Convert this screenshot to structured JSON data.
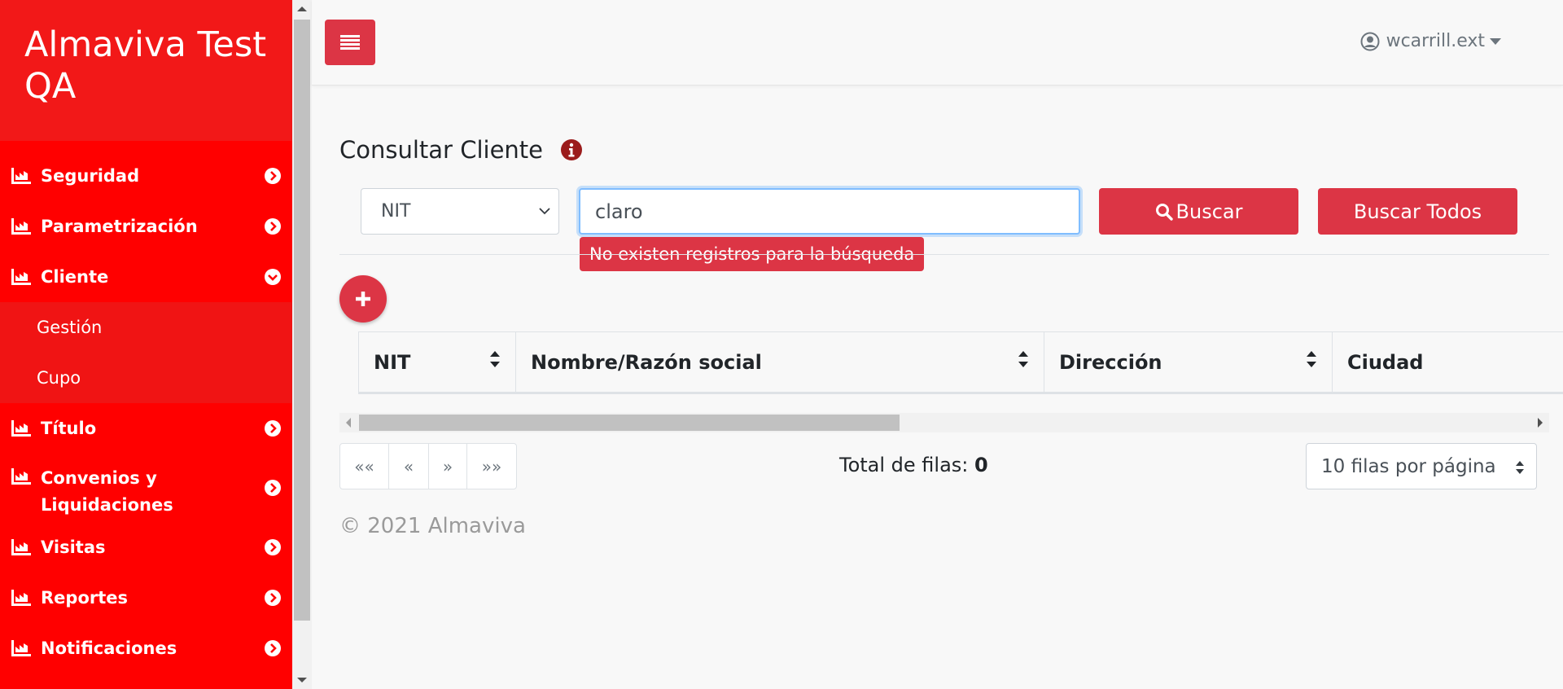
{
  "app": {
    "brand_title": "Almaviva Test QA",
    "accent": "#dc3545",
    "sidebar_color": "#ff0000"
  },
  "sidebar": {
    "items": [
      {
        "label": "Seguridad",
        "icon": "chart-icon",
        "expanded": false
      },
      {
        "label": "Parametrización",
        "icon": "chart-icon",
        "expanded": false
      },
      {
        "label": "Cliente",
        "icon": "chart-icon",
        "expanded": true,
        "children": [
          {
            "label": "Gestión"
          },
          {
            "label": "Cupo"
          }
        ]
      },
      {
        "label": "Título",
        "icon": "chart-icon",
        "expanded": false
      },
      {
        "label": "Convenios y Liquidaciones",
        "icon": "chart-icon",
        "expanded": false
      },
      {
        "label": "Visitas",
        "icon": "chart-icon",
        "expanded": false
      },
      {
        "label": "Reportes",
        "icon": "chart-icon",
        "expanded": false
      },
      {
        "label": "Notificaciones",
        "icon": "chart-icon",
        "expanded": false
      }
    ]
  },
  "header": {
    "user_name": "wcarrill.ext",
    "menu_icon": "hamburger-icon",
    "user_icon": "user-circle-icon"
  },
  "main": {
    "page_title": "Consultar Cliente",
    "search": {
      "type_selected": "NIT",
      "query_value": "claro",
      "error_tooltip": "No existen registros para la búsqueda",
      "search_label": "Buscar",
      "search_all_label": "Buscar Todos"
    },
    "table": {
      "columns": [
        {
          "label": "NIT",
          "sortable": true
        },
        {
          "label": "Nombre/Razón social",
          "sortable": true
        },
        {
          "label": "Dirección",
          "sortable": true
        },
        {
          "label": "Ciudad",
          "sortable": false
        }
      ],
      "rows": []
    },
    "pagination": {
      "first": "««",
      "prev": "«",
      "next": "»",
      "last": "»»",
      "total_label": "Total de filas:",
      "total_value": "0",
      "per_page": "10 filas por página"
    },
    "footer": "© 2021 Almaviva"
  }
}
